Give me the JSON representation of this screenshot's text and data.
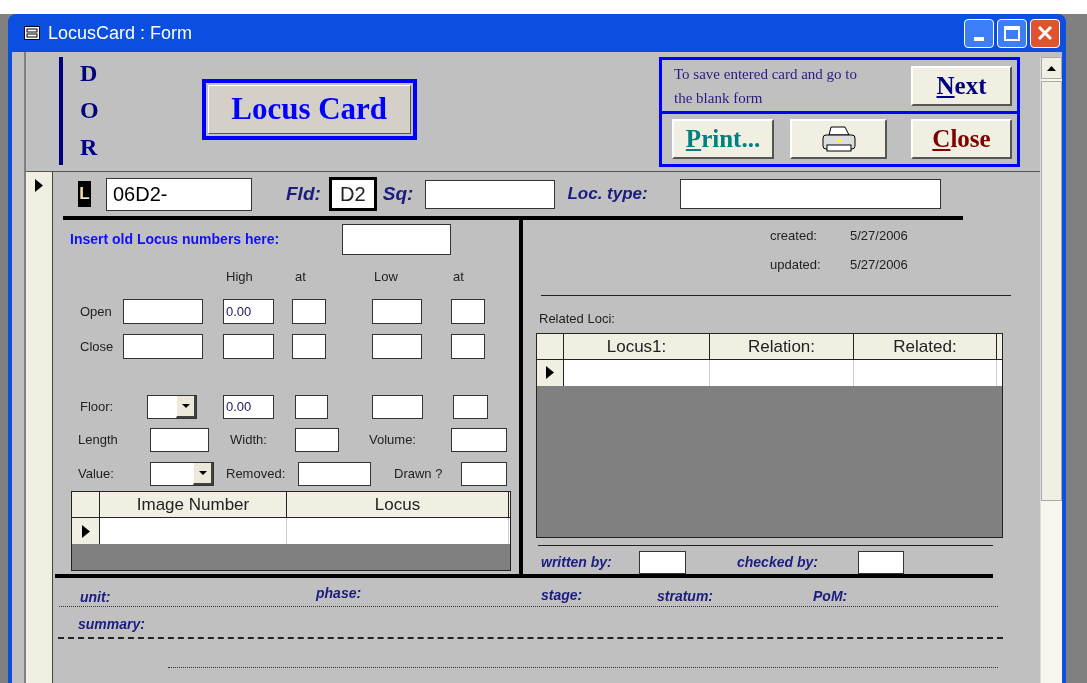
{
  "window": {
    "title": "LocusCard : Form"
  },
  "header": {
    "letters": [
      "D",
      "O",
      "R"
    ],
    "title": "Locus Card",
    "hint": "To save entered card and go to the blank form",
    "buttons": [
      {
        "kind": "next",
        "accel": "N",
        "rest": "ext"
      },
      {
        "kind": "print",
        "accel": "P",
        "rest": "rint..."
      },
      {
        "kind": "printer"
      },
      {
        "kind": "close",
        "accel": "C",
        "rest": "lose"
      }
    ]
  },
  "record": {
    "prefix": "L",
    "locus": "06D2-",
    "fld_label": "Fld:",
    "fld": "D2",
    "sq_label": "Sq:",
    "loc_type_label": "Loc. type:"
  },
  "left": {
    "old_locus_label": "Insert old Locus numbers here:",
    "heads": [
      "High",
      "at",
      "Low",
      "at"
    ],
    "levels": [
      {
        "label": "Open",
        "high": "0.00"
      },
      {
        "label": "Close"
      }
    ],
    "floor": {
      "label": "Floor:",
      "high": "0.00"
    },
    "length_label": "Length",
    "width_label": "Width:",
    "volume_label": "Volume:",
    "value_label": "Value:",
    "removed_label": "Removed:",
    "drawn_label": "Drawn ?",
    "images_table": {
      "columns": [
        "Image Number",
        "Locus"
      ]
    }
  },
  "right": {
    "created_label": "created:",
    "created": "5/27/2006",
    "updated_label": "updated:",
    "updated": "5/27/2006",
    "related_label": "Related Loci:",
    "related_table": {
      "columns": [
        "Locus1:",
        "Relation:",
        "Related:"
      ]
    },
    "written_label": "written by:",
    "checked_label": "checked by:"
  },
  "footer": {
    "unit": "unit:",
    "phase": "phase:",
    "stage": "stage:",
    "stratum": "stratum:",
    "pom": "PoM:",
    "summary": "summary:"
  }
}
